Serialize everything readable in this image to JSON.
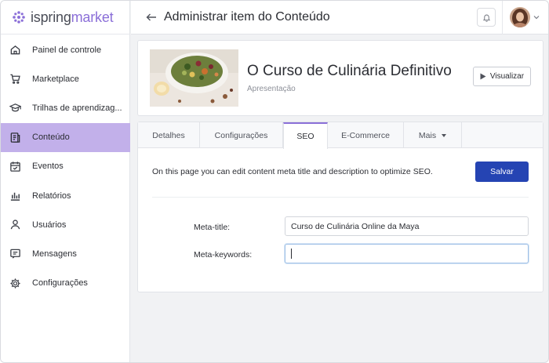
{
  "brand": {
    "logo_part1": "ispring",
    "logo_part2": "market",
    "accent": "#8b6fd8"
  },
  "sidebar": {
    "items": [
      {
        "label": "Painel de controle",
        "icon": "home-icon",
        "active": false
      },
      {
        "label": "Marketplace",
        "icon": "cart-icon",
        "active": false
      },
      {
        "label": "Trilhas de aprendizag...",
        "icon": "graduation-cap-icon",
        "active": false
      },
      {
        "label": "Conteúdo",
        "icon": "document-icon",
        "active": true
      },
      {
        "label": "Eventos",
        "icon": "calendar-icon",
        "active": false
      },
      {
        "label": "Relatórios",
        "icon": "bar-chart-icon",
        "active": false
      },
      {
        "label": "Usuários",
        "icon": "user-icon",
        "active": false
      },
      {
        "label": "Mensagens",
        "icon": "message-icon",
        "active": false
      },
      {
        "label": "Configurações",
        "icon": "gear-icon",
        "active": false
      }
    ]
  },
  "header": {
    "title": "Administrar item do Conteúdo"
  },
  "course": {
    "title": "O Curso de Culinária Definitivo",
    "subtitle": "Apresentação",
    "view_button": "Visualizar"
  },
  "tabs": [
    {
      "label": "Detalhes",
      "active": false
    },
    {
      "label": "Configurações",
      "active": false
    },
    {
      "label": "SEO",
      "active": true
    },
    {
      "label": "E-Commerce",
      "active": false
    },
    {
      "label": "Mais",
      "active": false
    }
  ],
  "seo": {
    "description": "On this page you can edit content meta title and description to optimize SEO.",
    "save_button": "Salvar",
    "meta_title_label": "Meta-title:",
    "meta_title_value": "Curso de Culinária Online da Maya",
    "meta_keywords_label": "Meta-keywords:",
    "meta_keywords_value": ""
  }
}
